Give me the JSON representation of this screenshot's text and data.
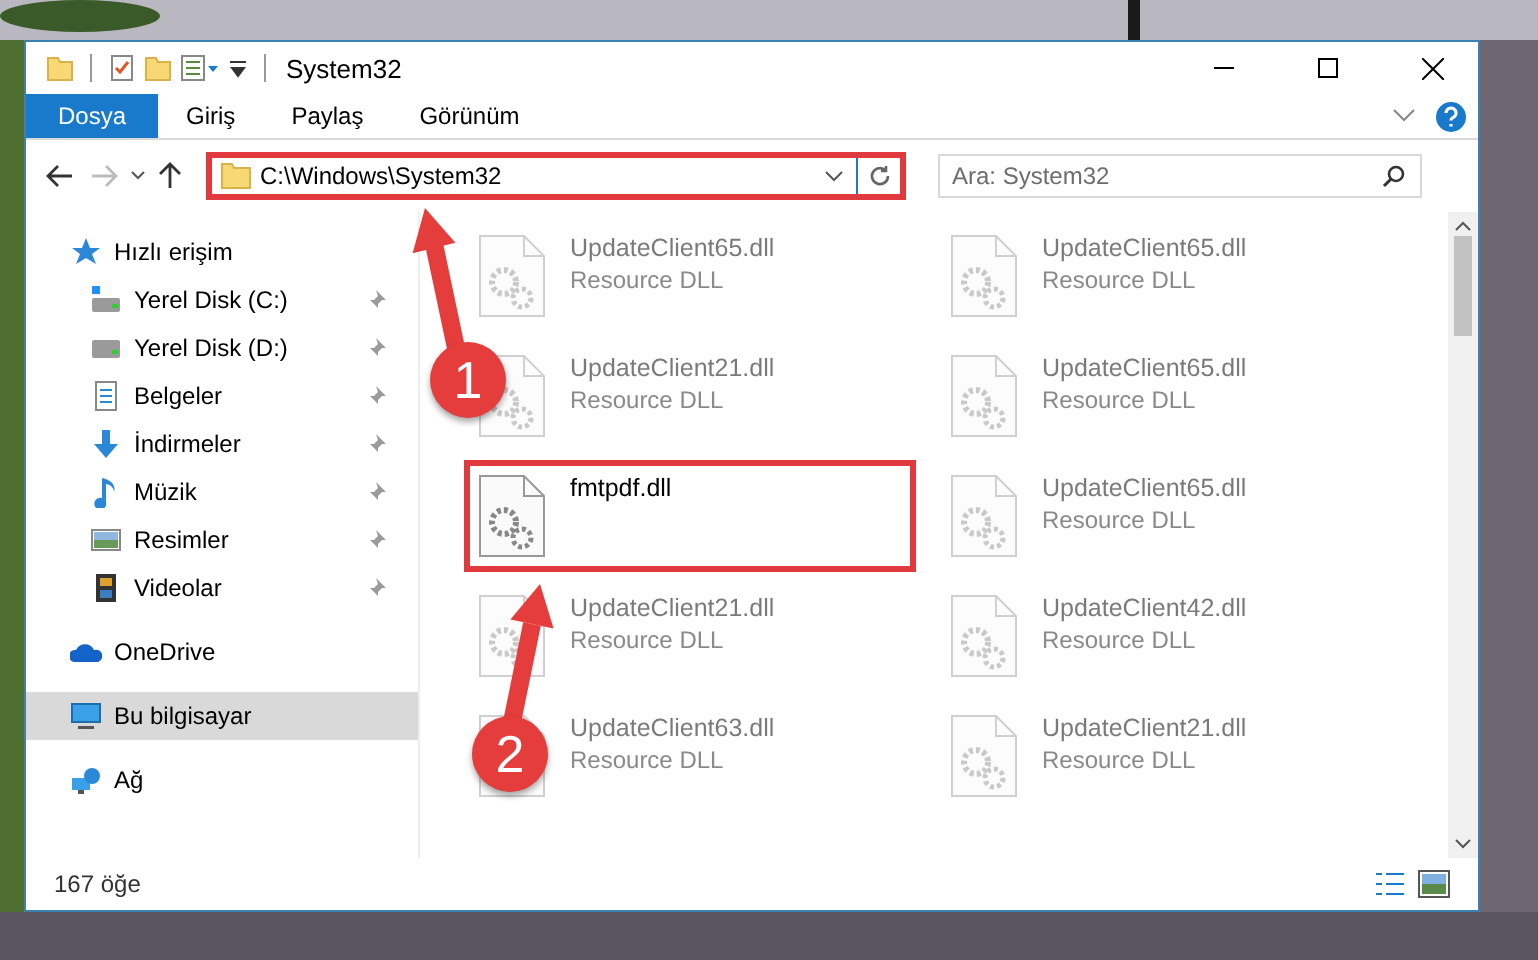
{
  "window": {
    "title": "System32"
  },
  "ribbon": {
    "tabs": [
      {
        "label": "Dosya",
        "kind": "file"
      },
      {
        "label": "Giriş",
        "kind": "tab"
      },
      {
        "label": "Paylaş",
        "kind": "tab"
      },
      {
        "label": "Görünüm",
        "kind": "tab"
      }
    ]
  },
  "navigation": {
    "back_enabled": true,
    "forward_enabled": false
  },
  "address_bar": {
    "value": "C:\\Windows\\System32",
    "highlighted": true
  },
  "search": {
    "placeholder": "Ara: System32"
  },
  "sidebar": {
    "items": [
      {
        "label": "Hızlı erişim",
        "kind": "star",
        "selected": false,
        "children": [
          {
            "label": "Yerel Disk (C:)",
            "kind": "drive-c",
            "pinned": true,
            "selected": false
          },
          {
            "label": "Yerel Disk (D:)",
            "kind": "drive",
            "pinned": true,
            "selected": false
          },
          {
            "label": "Belgeler",
            "kind": "docs",
            "pinned": true,
            "selected": false
          },
          {
            "label": "İndirmeler",
            "kind": "download",
            "pinned": true,
            "selected": false
          },
          {
            "label": "Müzik",
            "kind": "music",
            "pinned": true,
            "selected": false
          },
          {
            "label": "Resimler",
            "kind": "pictures",
            "pinned": true,
            "selected": false
          },
          {
            "label": "Videolar",
            "kind": "video",
            "pinned": true,
            "selected": false
          }
        ]
      },
      {
        "label": "OneDrive",
        "kind": "cloud",
        "selected": false
      },
      {
        "label": "Bu bilgisayar",
        "kind": "pc",
        "selected": true
      },
      {
        "label": "Ağ",
        "kind": "network",
        "selected": false
      }
    ]
  },
  "files": [
    {
      "name": "UpdateClient65.dll",
      "type": "Resource DLL",
      "dimmed": true,
      "highlighted": false
    },
    {
      "name": "UpdateClient65.dll",
      "type": "Resource DLL",
      "dimmed": true,
      "highlighted": false
    },
    {
      "name": "UpdateClient21.dll",
      "type": "Resource DLL",
      "dimmed": true,
      "highlighted": false
    },
    {
      "name": "UpdateClient65.dll",
      "type": "Resource DLL",
      "dimmed": true,
      "highlighted": false
    },
    {
      "name": "fmtpdf.dll",
      "dimmed": false,
      "highlighted": true
    },
    {
      "name": "UpdateClient65.dll",
      "type": "Resource DLL",
      "dimmed": true,
      "highlighted": false
    },
    {
      "name": "UpdateClient21.dll",
      "type": "Resource DLL",
      "dimmed": true,
      "highlighted": false
    },
    {
      "name": "UpdateClient42.dll",
      "type": "Resource DLL",
      "dimmed": true,
      "highlighted": false
    },
    {
      "name": "UpdateClient63.dll",
      "type": "Resource DLL",
      "dimmed": true,
      "highlighted": false
    },
    {
      "name": "UpdateClient21.dll",
      "type": "Resource DLL",
      "dimmed": true,
      "highlighted": false
    }
  ],
  "status_bar": {
    "item_count": "167 öğe"
  },
  "callouts": [
    {
      "label": "1"
    },
    {
      "label": "2"
    }
  ]
}
